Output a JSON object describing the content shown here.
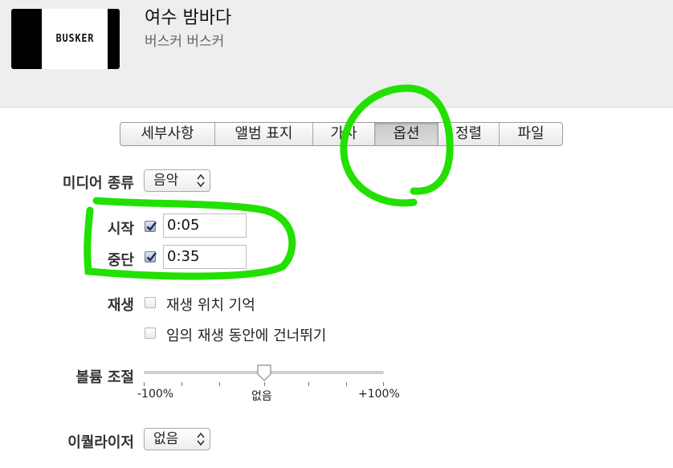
{
  "header": {
    "song_title": "여수 밤바다",
    "artist": "버스커 버스커",
    "artwork_text": "BUSKER"
  },
  "tabs": [
    {
      "label": "세부사항",
      "active": false
    },
    {
      "label": "앨범 표지",
      "active": false
    },
    {
      "label": "가사",
      "active": false
    },
    {
      "label": "옵션",
      "active": true
    },
    {
      "label": "정렬",
      "active": false
    },
    {
      "label": "파일",
      "active": false
    }
  ],
  "media_kind": {
    "label": "미디어 종류",
    "value": "음악"
  },
  "start": {
    "label": "시작",
    "checked": true,
    "value": "0:05"
  },
  "stop": {
    "label": "중단",
    "checked": true,
    "value": "0:35"
  },
  "playback": {
    "label": "재생",
    "remember_position": {
      "label": "재생 위치 기억",
      "checked": false
    },
    "skip_shuffle": {
      "label": "임의 재생 동안에 건너뛰기",
      "checked": false
    }
  },
  "volume": {
    "label": "볼륨 조절",
    "min_label": "-100%",
    "mid_label": "없음",
    "max_label": "+100%",
    "value_percent": 0
  },
  "equalizer": {
    "label": "이퀄라이저",
    "value": "없음"
  },
  "colors": {
    "annotation": "#22e000",
    "header_bg": "#eeeeee"
  }
}
